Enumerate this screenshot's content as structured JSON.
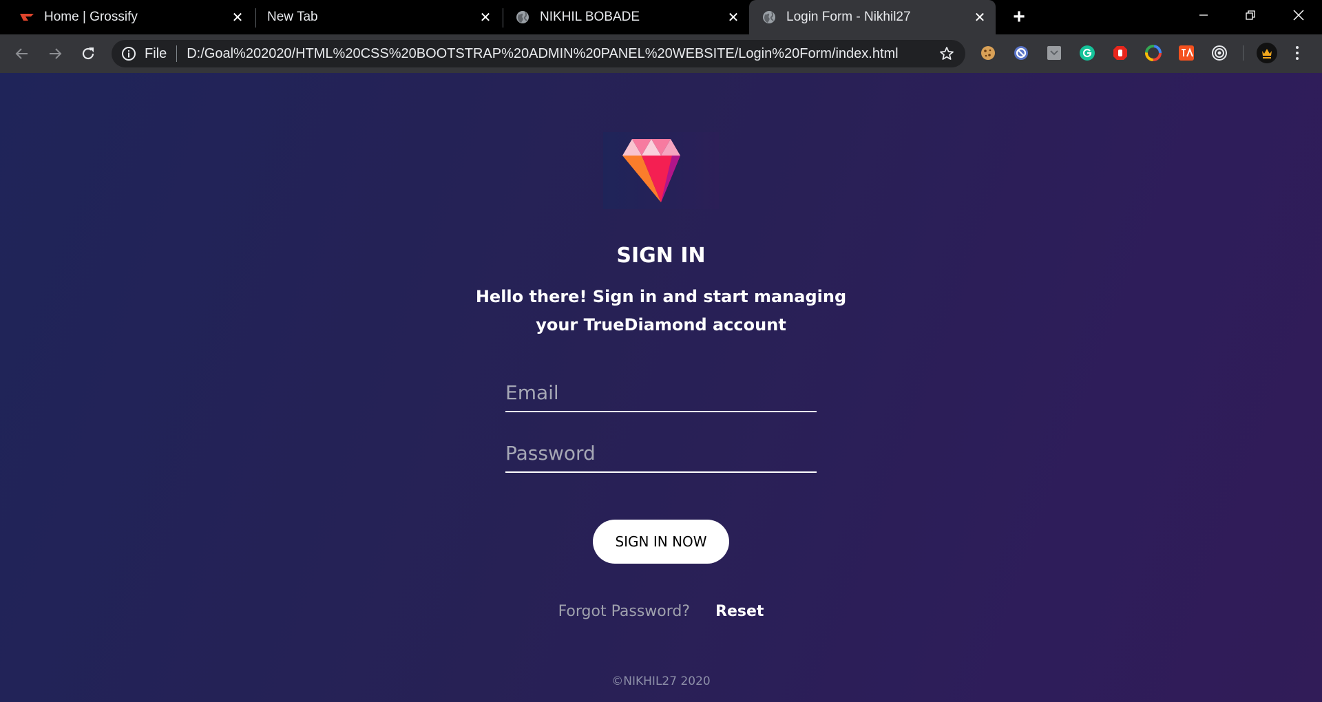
{
  "browser": {
    "tabs": [
      {
        "title": "Home | Grossify",
        "favicon": "grossify-icon"
      },
      {
        "title": "New Tab",
        "favicon": ""
      },
      {
        "title": "NIKHIL BOBADE",
        "favicon": "globe-icon"
      },
      {
        "title": "Login Form - Nikhil27",
        "favicon": "globe-icon",
        "active": true
      }
    ],
    "omnibox": {
      "scheme_label": "File",
      "url": "D:/Goal%202020/HTML%20CSS%20BOOTSTRAP%20ADMIN%20PANEL%20WEBSITE/Login%20Form/index.html"
    },
    "extensions": [
      "cookie-icon",
      "blocker-icon",
      "pocket-icon",
      "grammarly-icon",
      "stop-hand-icon",
      "color-wheel-icon",
      "translate-icon",
      "target-icon",
      "avatar-icon"
    ],
    "colors": {
      "tabstrip": "#000000",
      "toolbar": "#35363a",
      "omnibox": "#202124"
    }
  },
  "page": {
    "logo": "diamond-logo",
    "heading": "SIGN IN",
    "subtitle": "Hello there! Sign in and start managing your TrueDiamond account",
    "email_placeholder": "Email",
    "password_placeholder": "Password",
    "submit_label": "SIGN IN NOW",
    "forgot_label": "Forgot Password?",
    "reset_label": "Reset",
    "footer": "©NIKHIL27 2020",
    "colors": {
      "background_start": "#1f2459",
      "background_end": "#311c58",
      "button": "#ffffff",
      "text": "#ffffff"
    }
  }
}
